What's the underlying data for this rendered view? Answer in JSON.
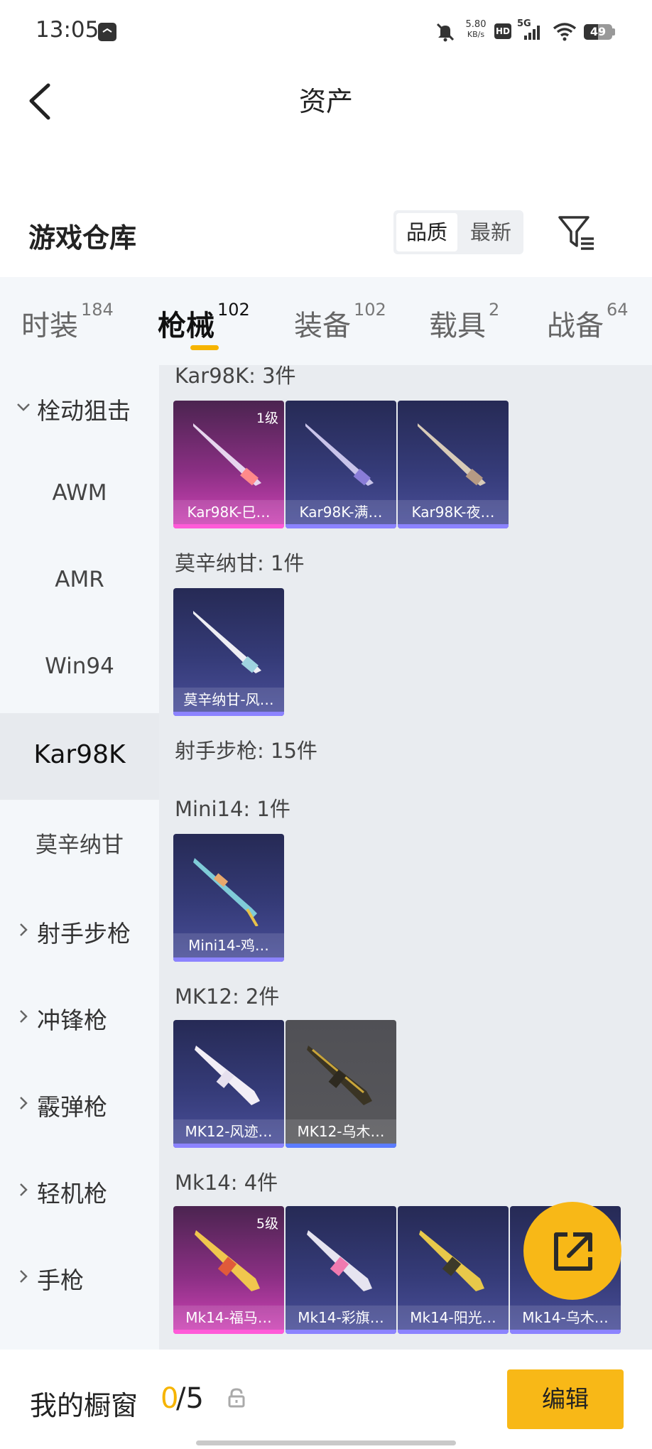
{
  "status": {
    "time": "13:05",
    "net_speed": "5.80",
    "net_unit": "KB/s",
    "hd": "HD",
    "signal": "5G",
    "battery": "49"
  },
  "nav": {
    "title": "资产"
  },
  "warehouse": {
    "title": "游戏仓库",
    "sort_quality": "品质",
    "sort_newest": "最新"
  },
  "tabs": [
    {
      "label": "时装",
      "count": "184"
    },
    {
      "label": "枪械",
      "count": "102"
    },
    {
      "label": "装备",
      "count": "102"
    },
    {
      "label": "载具",
      "count": "2"
    },
    {
      "label": "战备",
      "count": "64"
    }
  ],
  "sidebar": [
    {
      "label": "栓动狙击"
    },
    {
      "label": "AWM"
    },
    {
      "label": "AMR"
    },
    {
      "label": "Win94"
    },
    {
      "label": "Kar98K"
    },
    {
      "label": "莫辛纳甘"
    },
    {
      "label": "射手步枪"
    },
    {
      "label": "冲锋枪"
    },
    {
      "label": "霰弹枪"
    },
    {
      "label": "轻机枪"
    },
    {
      "label": "手枪"
    }
  ],
  "content": {
    "kar98k": {
      "heading": "Kar98K: 3件",
      "items": [
        {
          "name": "Kar98K-巳…",
          "level": "1级"
        },
        {
          "name": "Kar98K-满…"
        },
        {
          "name": "Kar98K-夜…"
        }
      ]
    },
    "mosin": {
      "heading": "莫辛纳甘: 1件",
      "items": [
        {
          "name": "莫辛纳甘-风…"
        }
      ]
    },
    "dmr": {
      "heading": "射手步枪: 15件"
    },
    "mini14": {
      "heading": "Mini14: 1件",
      "items": [
        {
          "name": "Mini14-鸡…"
        }
      ]
    },
    "mk12": {
      "heading": "MK12: 2件",
      "items": [
        {
          "name": "MK12-风迹…"
        },
        {
          "name": "MK12-乌木…"
        }
      ]
    },
    "mk14": {
      "heading": "Mk14: 4件",
      "items": [
        {
          "name": "Mk14-福马…",
          "level": "5级"
        },
        {
          "name": "Mk14-彩旗…"
        },
        {
          "name": "Mk14-阳光…"
        },
        {
          "name": "Mk14-乌木…"
        }
      ]
    }
  },
  "showcase": {
    "label": "我的橱窗",
    "current": "0",
    "total": "/5",
    "edit": "编辑"
  },
  "colors": {
    "accent": "#f8b817",
    "rare_purple": "#8c83ff",
    "legend_pink": "#ff5ad8"
  }
}
